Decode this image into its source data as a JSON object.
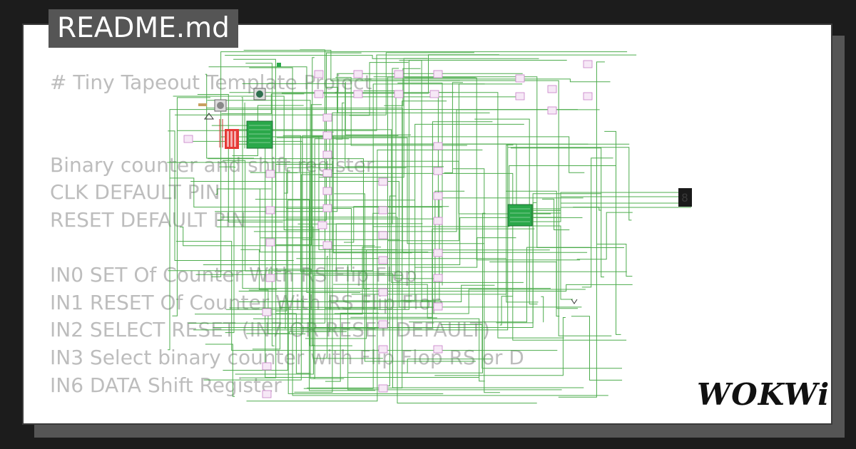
{
  "file_tab": {
    "label": "README.md"
  },
  "readme": {
    "lines": [
      "# Tiny Tapeout Template Project",
      "",
      "",
      "Binary counter and shift register",
      "CLK DEFAULT PIN",
      "RESET DEFAULT PIN",
      "",
      "IN0 SET Of Counter With RS Flip Flop",
      "IN1 RESET Of Counter With RS Flip Flop",
      "IN2 SELECT RESET (IN7 OR RESET DEFAULT)",
      "IN3 Select binary counter with Flip Flop RS or D",
      "IN6 DATA Shift Register"
    ]
  },
  "branding": {
    "logo_text": "WOKWi"
  },
  "colors": {
    "background": "#1c1c1c",
    "card": "#ffffff",
    "tab": "#555555",
    "readme_text": "#bdbdbd",
    "wire": "#2e9e2e",
    "chip": "#2aa84a",
    "gate": "#c77dc7",
    "dip_switch": "#e53935",
    "seven_segment": "#1a1a1a"
  },
  "icons": [
    "wokwi-logo",
    "seven-segment-display",
    "dip-switch",
    "push-button",
    "flip-flop-gate",
    "ground-icon"
  ]
}
